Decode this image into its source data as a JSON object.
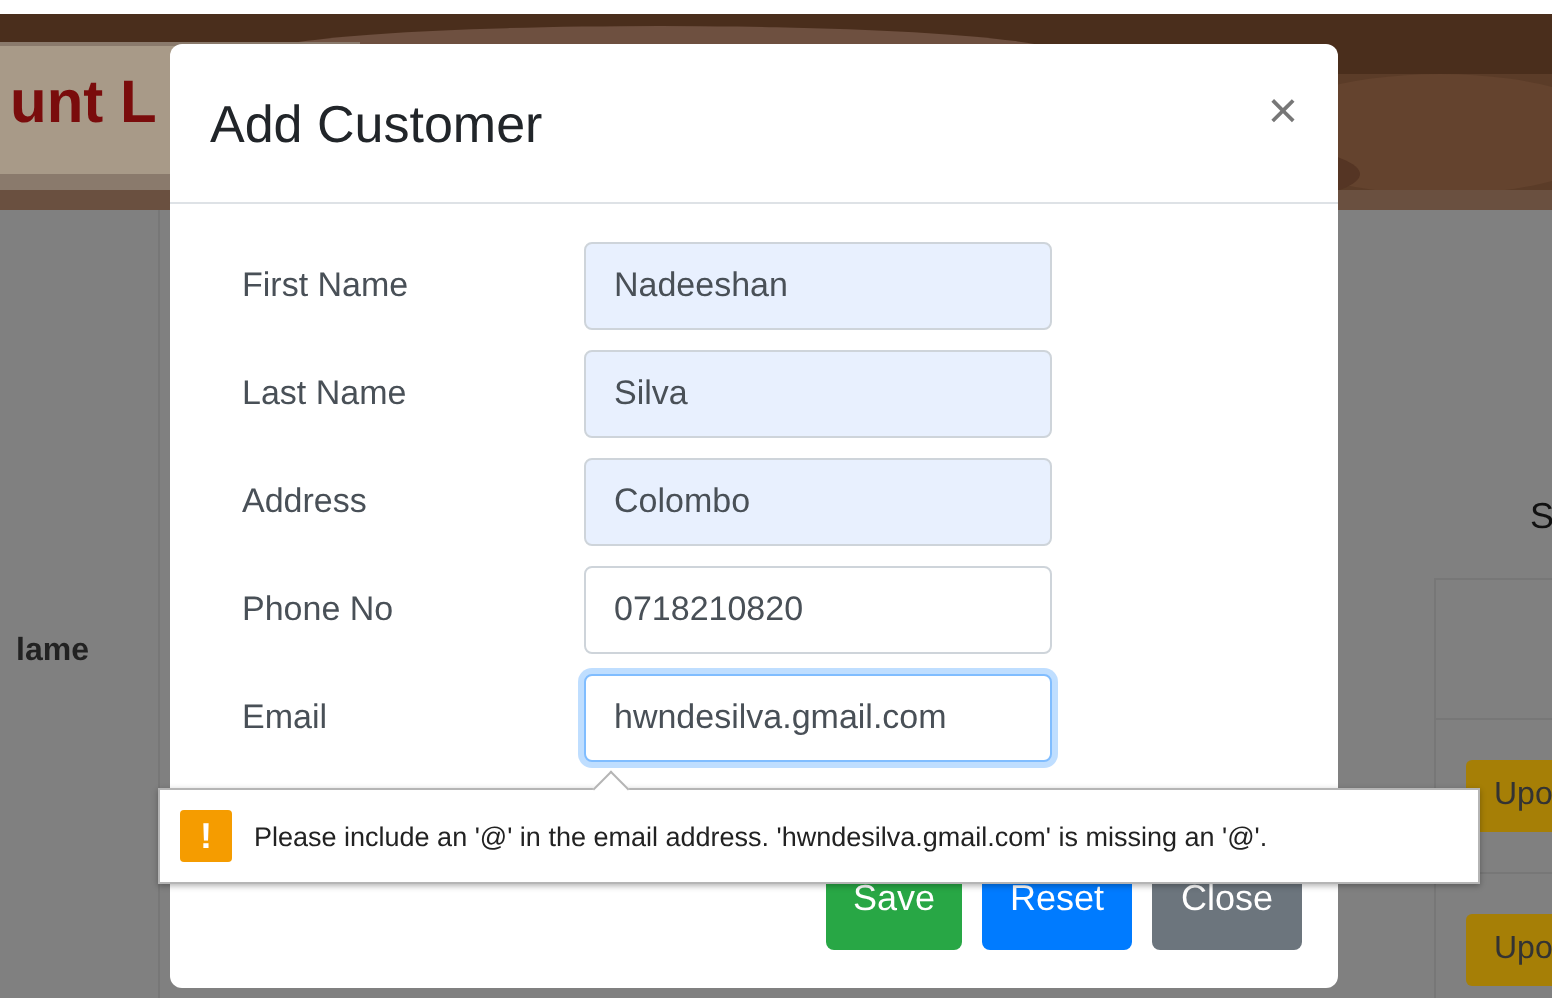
{
  "background": {
    "heading": "unt L",
    "table_header": "lame",
    "side_label": "S",
    "row_buttons": [
      "Upo",
      "Upo"
    ]
  },
  "modal": {
    "title": "Add Customer",
    "close": "×",
    "fields": [
      {
        "label": "First Name",
        "value": "Nadeeshan",
        "autofilled": true,
        "focused": false
      },
      {
        "label": "Last Name",
        "value": "Silva",
        "autofilled": true,
        "focused": false
      },
      {
        "label": "Address",
        "value": "Colombo",
        "autofilled": true,
        "focused": false
      },
      {
        "label": "Phone No",
        "value": "0718210820",
        "autofilled": false,
        "focused": false
      },
      {
        "label": "Email",
        "value": "hwndesilva.gmail.com",
        "autofilled": false,
        "focused": true
      }
    ],
    "buttons": [
      {
        "label": "Save",
        "kind": "success"
      },
      {
        "label": "Reset",
        "kind": "primary"
      },
      {
        "label": "Close",
        "kind": "secondary"
      }
    ]
  },
  "validation_tooltip": {
    "icon": "!",
    "message": "Please include an '@' in the email address. 'hwndesilva.gmail.com' is missing an '@'."
  }
}
